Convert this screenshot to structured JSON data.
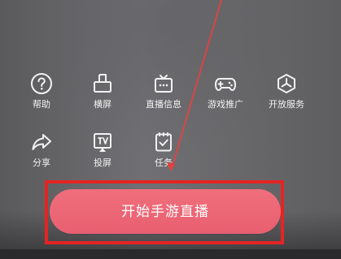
{
  "menu": {
    "items": [
      {
        "label": "帮助",
        "icon": "help-circle-icon"
      },
      {
        "label": "横屏",
        "icon": "landscape-screen-icon"
      },
      {
        "label": "直播信息",
        "icon": "tv-info-icon"
      },
      {
        "label": "游戏推广",
        "icon": "gamepad-icon"
      },
      {
        "label": "开放服务",
        "icon": "open-service-cube-icon"
      },
      {
        "label": "分享",
        "icon": "share-arrow-icon"
      },
      {
        "label": "投屏",
        "icon": "screen-cast-icon"
      },
      {
        "label": "任务",
        "icon": "task-checklist-icon"
      }
    ]
  },
  "action": {
    "start_label": "开始手游直播"
  },
  "colors": {
    "button": "#ec6677",
    "highlight": "#e42424",
    "text": "#f2f2f2"
  }
}
